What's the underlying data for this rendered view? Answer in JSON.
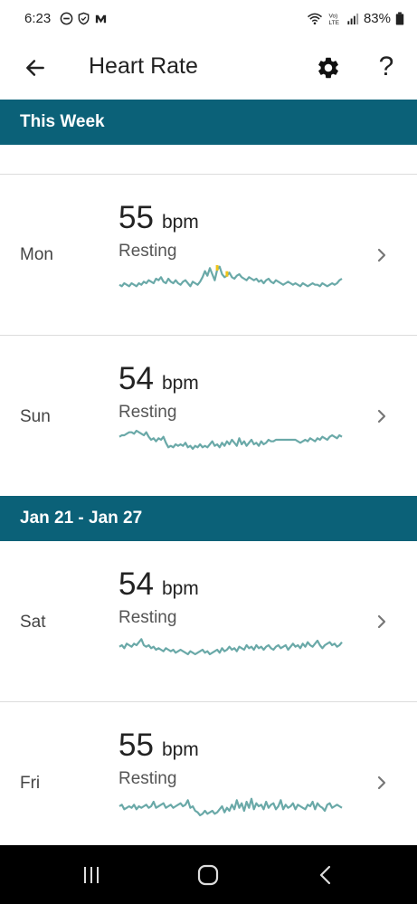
{
  "status_bar": {
    "time": "6:23",
    "battery": "83%",
    "icons": [
      "do-not-disturb-icon",
      "shield-icon",
      "app-notification-icon",
      "wifi-icon",
      "volte-icon",
      "signal-icon",
      "battery-icon"
    ]
  },
  "header": {
    "title": "Heart Rate",
    "back_icon": "arrow-left-icon",
    "settings_icon": "gear-icon",
    "help_label": "?"
  },
  "sections": [
    {
      "title": "This Week",
      "days": [
        {
          "day": "Mon",
          "bpm": "55",
          "unit": "bpm",
          "label": "Resting",
          "trend": [
            51,
            50,
            52,
            51,
            50,
            52,
            51,
            50,
            52,
            51,
            53,
            52,
            54,
            53,
            52,
            55,
            54,
            56,
            53,
            52,
            55,
            53,
            52,
            54,
            52,
            51,
            53,
            54,
            52,
            50,
            53,
            52,
            51,
            53,
            56,
            60,
            57,
            62,
            58,
            54,
            61,
            63,
            58,
            56,
            57,
            59,
            56,
            55,
            57,
            58,
            56,
            55,
            54,
            56,
            55,
            54,
            55,
            53,
            54,
            52,
            54,
            55,
            53,
            52,
            54,
            53,
            52,
            51,
            52,
            53,
            52,
            51,
            52,
            51,
            50,
            52,
            51,
            50,
            51,
            52,
            51,
            51,
            50,
            52,
            51,
            50,
            51,
            52,
            51,
            52,
            54,
            55
          ],
          "highlights": [
            40,
            44
          ]
        },
        {
          "day": "Sun",
          "bpm": "54",
          "unit": "bpm",
          "label": "Resting",
          "trend": [
            57,
            58,
            58,
            59,
            60,
            60,
            59,
            61,
            60,
            59,
            58,
            60,
            57,
            55,
            56,
            54,
            56,
            55,
            57,
            53,
            50,
            51,
            50,
            52,
            51,
            52,
            51,
            53,
            50,
            51,
            49,
            51,
            50,
            52,
            50,
            51,
            50,
            52,
            54,
            51,
            52,
            50,
            53,
            51,
            54,
            52,
            55,
            53,
            51,
            56,
            52,
            54,
            51,
            53,
            55,
            52,
            53,
            51,
            54,
            52,
            53,
            55,
            54,
            54,
            55,
            55,
            55,
            55,
            55,
            55,
            55,
            55,
            55,
            54,
            53,
            54,
            55,
            54,
            56,
            55,
            54,
            56,
            55,
            57,
            56,
            55,
            57,
            58,
            57,
            56,
            58,
            57
          ]
        }
      ]
    },
    {
      "title": "Jan 21 - Jan 27",
      "days": [
        {
          "day": "Sat",
          "bpm": "54",
          "unit": "bpm",
          "label": "Resting",
          "trend": [
            54,
            55,
            53,
            56,
            55,
            54,
            56,
            55,
            57,
            59,
            55,
            54,
            55,
            53,
            54,
            52,
            53,
            52,
            51,
            53,
            52,
            51,
            52,
            50,
            51,
            52,
            51,
            50,
            49,
            51,
            50,
            49,
            50,
            51,
            52,
            50,
            51,
            49,
            50,
            51,
            52,
            50,
            53,
            51,
            52,
            54,
            52,
            53,
            51,
            54,
            53,
            52,
            55,
            53,
            54,
            52,
            55,
            53,
            54,
            52,
            54,
            55,
            53,
            52,
            54,
            55,
            53,
            54,
            55,
            52,
            54,
            56,
            54,
            55,
            53,
            56,
            54,
            57,
            55,
            54,
            56,
            58,
            55,
            53,
            55,
            56,
            57,
            55,
            56,
            54,
            55,
            57
          ],
          "highlights": []
        },
        {
          "day": "Fri",
          "bpm": "55",
          "unit": "bpm",
          "label": "Resting",
          "trend": [
            55,
            56,
            53,
            54,
            55,
            54,
            56,
            53,
            55,
            54,
            55,
            56,
            54,
            55,
            58,
            54,
            55,
            56,
            57,
            54,
            55,
            56,
            54,
            55,
            56,
            57,
            55,
            56,
            59,
            54,
            55,
            52,
            51,
            49,
            50,
            52,
            50,
            51,
            52,
            50,
            51,
            53,
            55,
            51,
            54,
            52,
            56,
            53,
            59,
            54,
            57,
            52,
            58,
            54,
            60,
            53,
            57,
            55,
            56,
            53,
            58,
            54,
            56,
            57,
            53,
            55,
            59,
            53,
            56,
            54,
            55,
            57,
            53,
            56,
            55,
            54,
            53,
            56,
            55,
            58,
            53,
            57,
            55,
            54,
            52,
            56,
            57,
            54,
            55,
            56,
            55,
            54
          ]
        }
      ]
    }
  ],
  "nav": {
    "recents_icon": "recent-apps-icon",
    "home_icon": "home-icon",
    "back_icon": "back-chevron-icon"
  },
  "colors": {
    "accent": "#0b6178",
    "sparkline": "#6aa9a8",
    "highlight": "#f0c419"
  }
}
